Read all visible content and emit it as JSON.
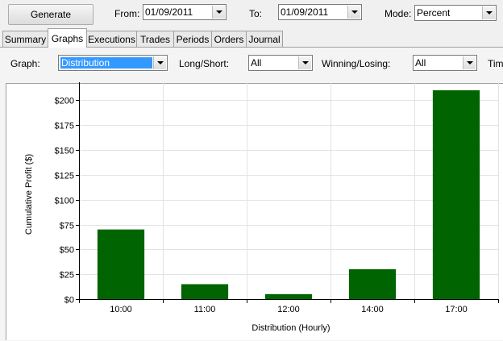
{
  "toolbar": {
    "generate_label": "Generate",
    "from_label": "From:",
    "from_value": "01/09/2011",
    "to_label": "To:",
    "to_value": "01/09/2011",
    "mode_label": "Mode:",
    "mode_value": "Percent"
  },
  "tabs": [
    "Summary",
    "Graphs",
    "Executions",
    "Trades",
    "Periods",
    "Orders",
    "Journal"
  ],
  "active_tab": "Graphs",
  "filters": {
    "graph_label": "Graph:",
    "graph_value": "Distribution",
    "long_short_label": "Long/Short:",
    "long_short_value": "All",
    "winning_losing_label": "Winning/Losing:",
    "winning_losing_value": "All",
    "time_label_partial": "Tim"
  },
  "colors": {
    "bar": "#006400",
    "grid": "#e3e3e3",
    "selection": "#3399ff"
  },
  "chart_data": {
    "type": "bar",
    "categories": [
      "10:00",
      "11:00",
      "12:00",
      "14:00",
      "17:00"
    ],
    "values": [
      70,
      15,
      5,
      30,
      210
    ],
    "xlabel": "Distribution (Hourly)",
    "ylabel": "Cumulative Profit ($)",
    "ylim": [
      0,
      210
    ],
    "yticks": [
      0,
      25,
      50,
      75,
      100,
      125,
      150,
      175,
      200
    ],
    "ytick_labels": [
      "$0",
      "$25",
      "$50",
      "$75",
      "$100",
      "$125",
      "$150",
      "$175",
      "$200"
    ],
    "grid": true
  }
}
